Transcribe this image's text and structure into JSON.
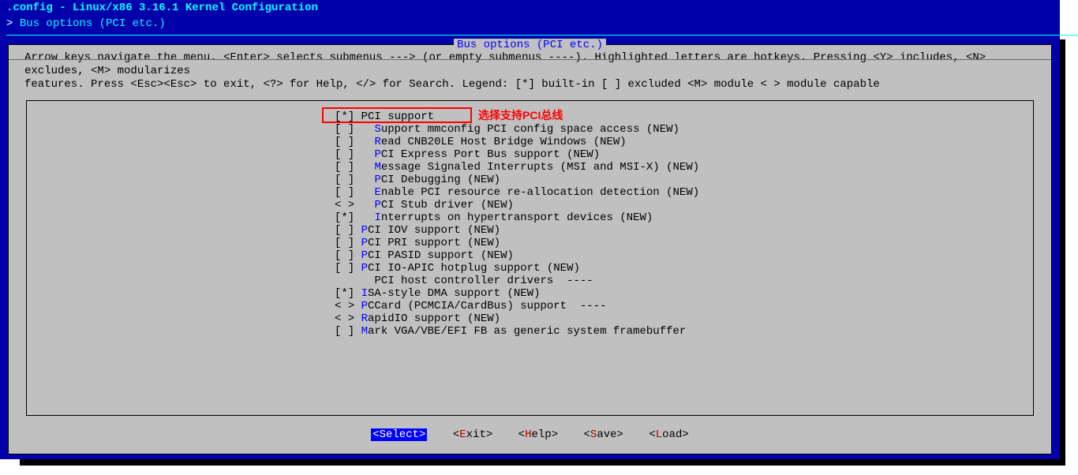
{
  "header": {
    "title": ".config - Linux/x86 3.16.1 Kernel Configuration",
    "breadcrumb_arrow": ">",
    "breadcrumb": "Bus options (PCI etc.)"
  },
  "panel_title": "Bus options (PCI etc.)",
  "help_lines": [
    "Arrow keys navigate the menu.  <Enter> selects submenus ---> (or empty submenus ----).  Highlighted letters are hotkeys.  Pressing <Y> includes, <N> excludes, <M> modularizes",
    "features.  Press <Esc><Esc> to exit, <?> for Help, </> for Search.  Legend: [*] built-in  [ ] excluded  <M> module  < > module capable"
  ],
  "annotation": "选择支持PCI总线",
  "menu": [
    {
      "bracket": "[*]",
      "indent": 0,
      "hk": "P",
      "text": "CI support",
      "new": false,
      "selected": true
    },
    {
      "bracket": "[ ]",
      "indent": 1,
      "hk": "S",
      "text": "upport mmconfig PCI config space access",
      "new": true
    },
    {
      "bracket": "[ ]",
      "indent": 1,
      "hk": "R",
      "text": "ead CNB20LE Host Bridge Windows",
      "new": true
    },
    {
      "bracket": "[ ]",
      "indent": 1,
      "hk": "P",
      "text": "CI Express Port Bus support",
      "new": true
    },
    {
      "bracket": "[ ]",
      "indent": 1,
      "hk": "M",
      "text": "essage Signaled Interrupts (MSI and MSI-X)",
      "new": true
    },
    {
      "bracket": "[ ]",
      "indent": 1,
      "hk": "P",
      "text": "CI Debugging",
      "new": true
    },
    {
      "bracket": "[ ]",
      "indent": 1,
      "hk": "E",
      "text": "nable PCI resource re-allocation detection",
      "new": true
    },
    {
      "bracket": "< >",
      "indent": 1,
      "hk": "P",
      "text": "CI Stub driver",
      "new": true
    },
    {
      "bracket": "[*]",
      "indent": 1,
      "hk": "I",
      "text": "nterrupts on hypertransport devices",
      "new": true
    },
    {
      "bracket": "[ ]",
      "indent": 0,
      "hk": "P",
      "text": "CI IOV support",
      "new": true
    },
    {
      "bracket": "[ ]",
      "indent": 0,
      "hk": "P",
      "text": "CI PRI support",
      "new": true
    },
    {
      "bracket": "[ ]",
      "indent": 0,
      "hk": "P",
      "text": "CI PASID support",
      "new": true
    },
    {
      "bracket": "[ ]",
      "indent": 0,
      "hk": "P",
      "text": "CI IO-APIC hotplug support",
      "new": true
    },
    {
      "bracket": "   ",
      "indent": 1,
      "hk": "",
      "text": "PCI host controller drivers  ----",
      "new": false
    },
    {
      "bracket": "[*]",
      "indent": 0,
      "hk": "I",
      "text": "SA-style DMA support",
      "new": true
    },
    {
      "bracket": "< >",
      "indent": 0,
      "hk": "P",
      "text": "CCard (PCMCIA/CardBus) support  ----",
      "new": false
    },
    {
      "bracket": "< >",
      "indent": 0,
      "hk": "R",
      "text": "apidIO support",
      "new": true
    },
    {
      "bracket": "[ ]",
      "indent": 0,
      "hk": "M",
      "text": "ark VGA/VBE/EFI FB as generic system framebuffer",
      "new": false
    }
  ],
  "buttons": [
    {
      "label": "Select",
      "hk": "S",
      "active": true
    },
    {
      "label": "Exit",
      "hk": "E",
      "active": false
    },
    {
      "label": "Help",
      "hk": "H",
      "active": false
    },
    {
      "label": "Save",
      "hk": "S",
      "active": false
    },
    {
      "label": "Load",
      "hk": "L",
      "active": false
    }
  ]
}
